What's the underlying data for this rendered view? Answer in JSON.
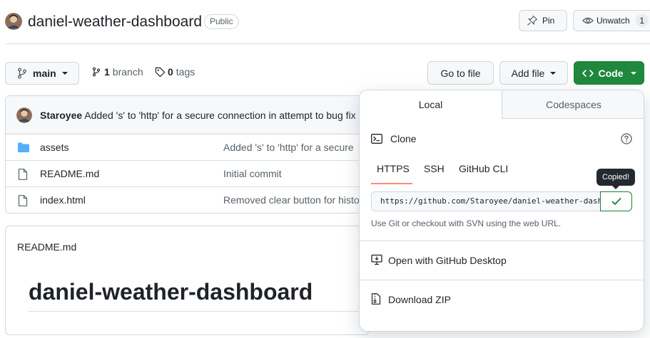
{
  "repo": {
    "name": "daniel-weather-dashboard",
    "visibility": "Public",
    "pin_label": "Pin",
    "unwatch_label": "Unwatch",
    "watch_count": "1"
  },
  "toolbar": {
    "branch": "main",
    "branch_count": "1",
    "branch_label": "branch",
    "tag_count": "0",
    "tag_label": "tags",
    "go_to_file": "Go to file",
    "add_file": "Add file",
    "code": "Code"
  },
  "commit": {
    "author": "Staroyee",
    "message": "Added 's' to 'http' for a secure connection in attempt to bug fix"
  },
  "files": [
    {
      "name": "assets",
      "type": "folder",
      "message": "Added 's' to 'http' for a secure"
    },
    {
      "name": "README.md",
      "type": "file",
      "message": "Initial commit"
    },
    {
      "name": "index.html",
      "type": "file",
      "message": "Removed clear button for histo"
    }
  ],
  "readme": {
    "label": "README.md",
    "heading": "daniel-weather-dashboard"
  },
  "code_dropdown": {
    "tabs": [
      "Local",
      "Codespaces"
    ],
    "active_tab": "Local",
    "clone_title": "Clone",
    "protocols": [
      "HTTPS",
      "SSH",
      "GitHub CLI"
    ],
    "active_protocol": "HTTPS",
    "clone_url": "https://github.com/Staroyee/daniel-weather-dashboard.git",
    "tooltip": "Copied!",
    "hint": "Use Git or checkout with SVN using the web URL.",
    "open_desktop": "Open with GitHub Desktop",
    "download_zip": "Download ZIP"
  },
  "colors": {
    "primary_green": "#1f883d",
    "folder_blue": "#54aeff",
    "active_tab_underline": "#fd8c73"
  },
  "icons": [
    "repo-avatar",
    "pin-icon",
    "eye-icon",
    "branch-icon",
    "tag-icon",
    "code-icon",
    "folder-icon",
    "file-icon",
    "terminal-icon",
    "question-icon",
    "check-icon",
    "desktop-icon",
    "zip-icon"
  ]
}
